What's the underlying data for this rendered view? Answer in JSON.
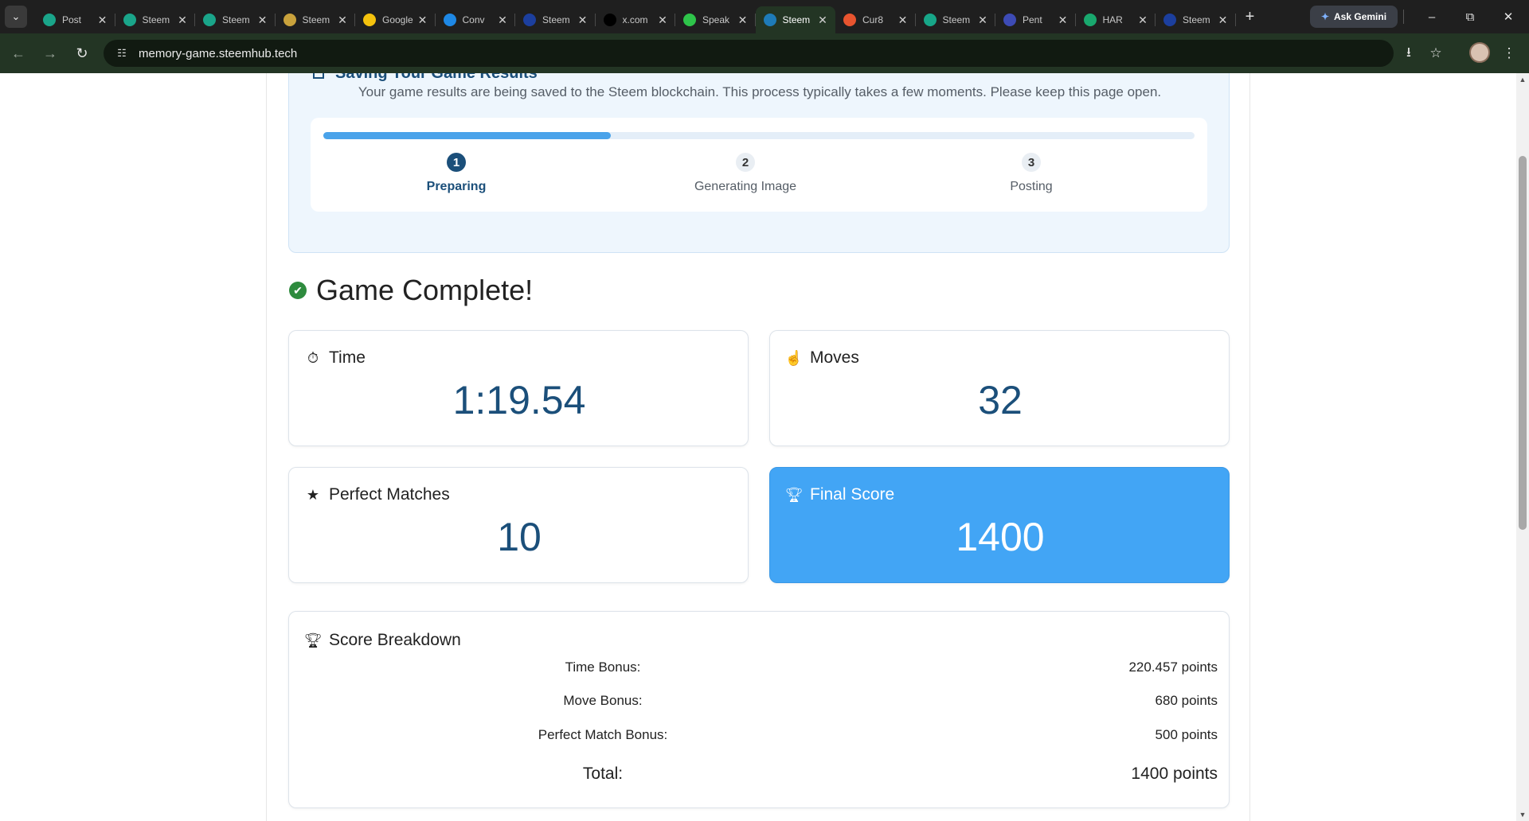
{
  "browser": {
    "tabs": [
      {
        "title": "Post",
        "favicon_color": "#1aa58a",
        "active": false
      },
      {
        "title": "Steem",
        "favicon_color": "#1aa58a",
        "active": false
      },
      {
        "title": "Steem",
        "favicon_color": "#1aa58a",
        "active": false
      },
      {
        "title": "Steem",
        "favicon_color": "#c9a23c",
        "active": false
      },
      {
        "title": "Google",
        "favicon_color": "#f4c20d",
        "active": false
      },
      {
        "title": "Conv",
        "favicon_color": "#1e88e5",
        "active": false
      },
      {
        "title": "Steem",
        "favicon_color": "#1c3f9e",
        "active": false
      },
      {
        "title": "x.com",
        "favicon_color": "#000000",
        "active": false
      },
      {
        "title": "Speak",
        "favicon_color": "#2ec44a",
        "active": false
      },
      {
        "title": "Steem",
        "favicon_color": "#1e7bb8",
        "active": true
      },
      {
        "title": "Cur8",
        "favicon_color": "#e8542f",
        "active": false
      },
      {
        "title": "Steem",
        "favicon_color": "#17a688",
        "active": false
      },
      {
        "title": "Pent",
        "favicon_color": "#3d4bb5",
        "active": false
      },
      {
        "title": "HAR",
        "favicon_color": "#19a86e",
        "active": false
      },
      {
        "title": "Steem",
        "favicon_color": "#1c3f9e",
        "active": false
      }
    ],
    "gemini_label": "Ask Gemini",
    "url": "memory-game.steemhub.tech"
  },
  "saving": {
    "title": "Saving Your Game Results",
    "description": "Your game results are being saved to the Steem blockchain. This process typically takes a few moments. Please keep this page open.",
    "progress_fraction": 0.33,
    "steps": [
      {
        "num": "1",
        "label": "Preparing",
        "active": true
      },
      {
        "num": "2",
        "label": "Generating Image",
        "active": false
      },
      {
        "num": "3",
        "label": "Posting",
        "active": false
      }
    ]
  },
  "result": {
    "heading": "Game Complete!",
    "stats": {
      "time": {
        "label": "Time",
        "value": "1:19.54"
      },
      "moves": {
        "label": "Moves",
        "value": "32"
      },
      "perfect": {
        "label": "Perfect Matches",
        "value": "10"
      },
      "score": {
        "label": "Final Score",
        "value": "1400"
      }
    }
  },
  "breakdown": {
    "title": "Score Breakdown",
    "rows": [
      {
        "label": "Time Bonus:",
        "value": "220.457 points"
      },
      {
        "label": "Move Bonus:",
        "value": "680 points"
      },
      {
        "label": "Perfect Match Bonus:",
        "value": "500 points"
      }
    ],
    "total": {
      "label": "Total:",
      "value": "1400 points"
    }
  },
  "colors": {
    "accent": "#42a5f5",
    "heading_blue": "#1b4f7a",
    "success_green": "#2e8b3e"
  }
}
